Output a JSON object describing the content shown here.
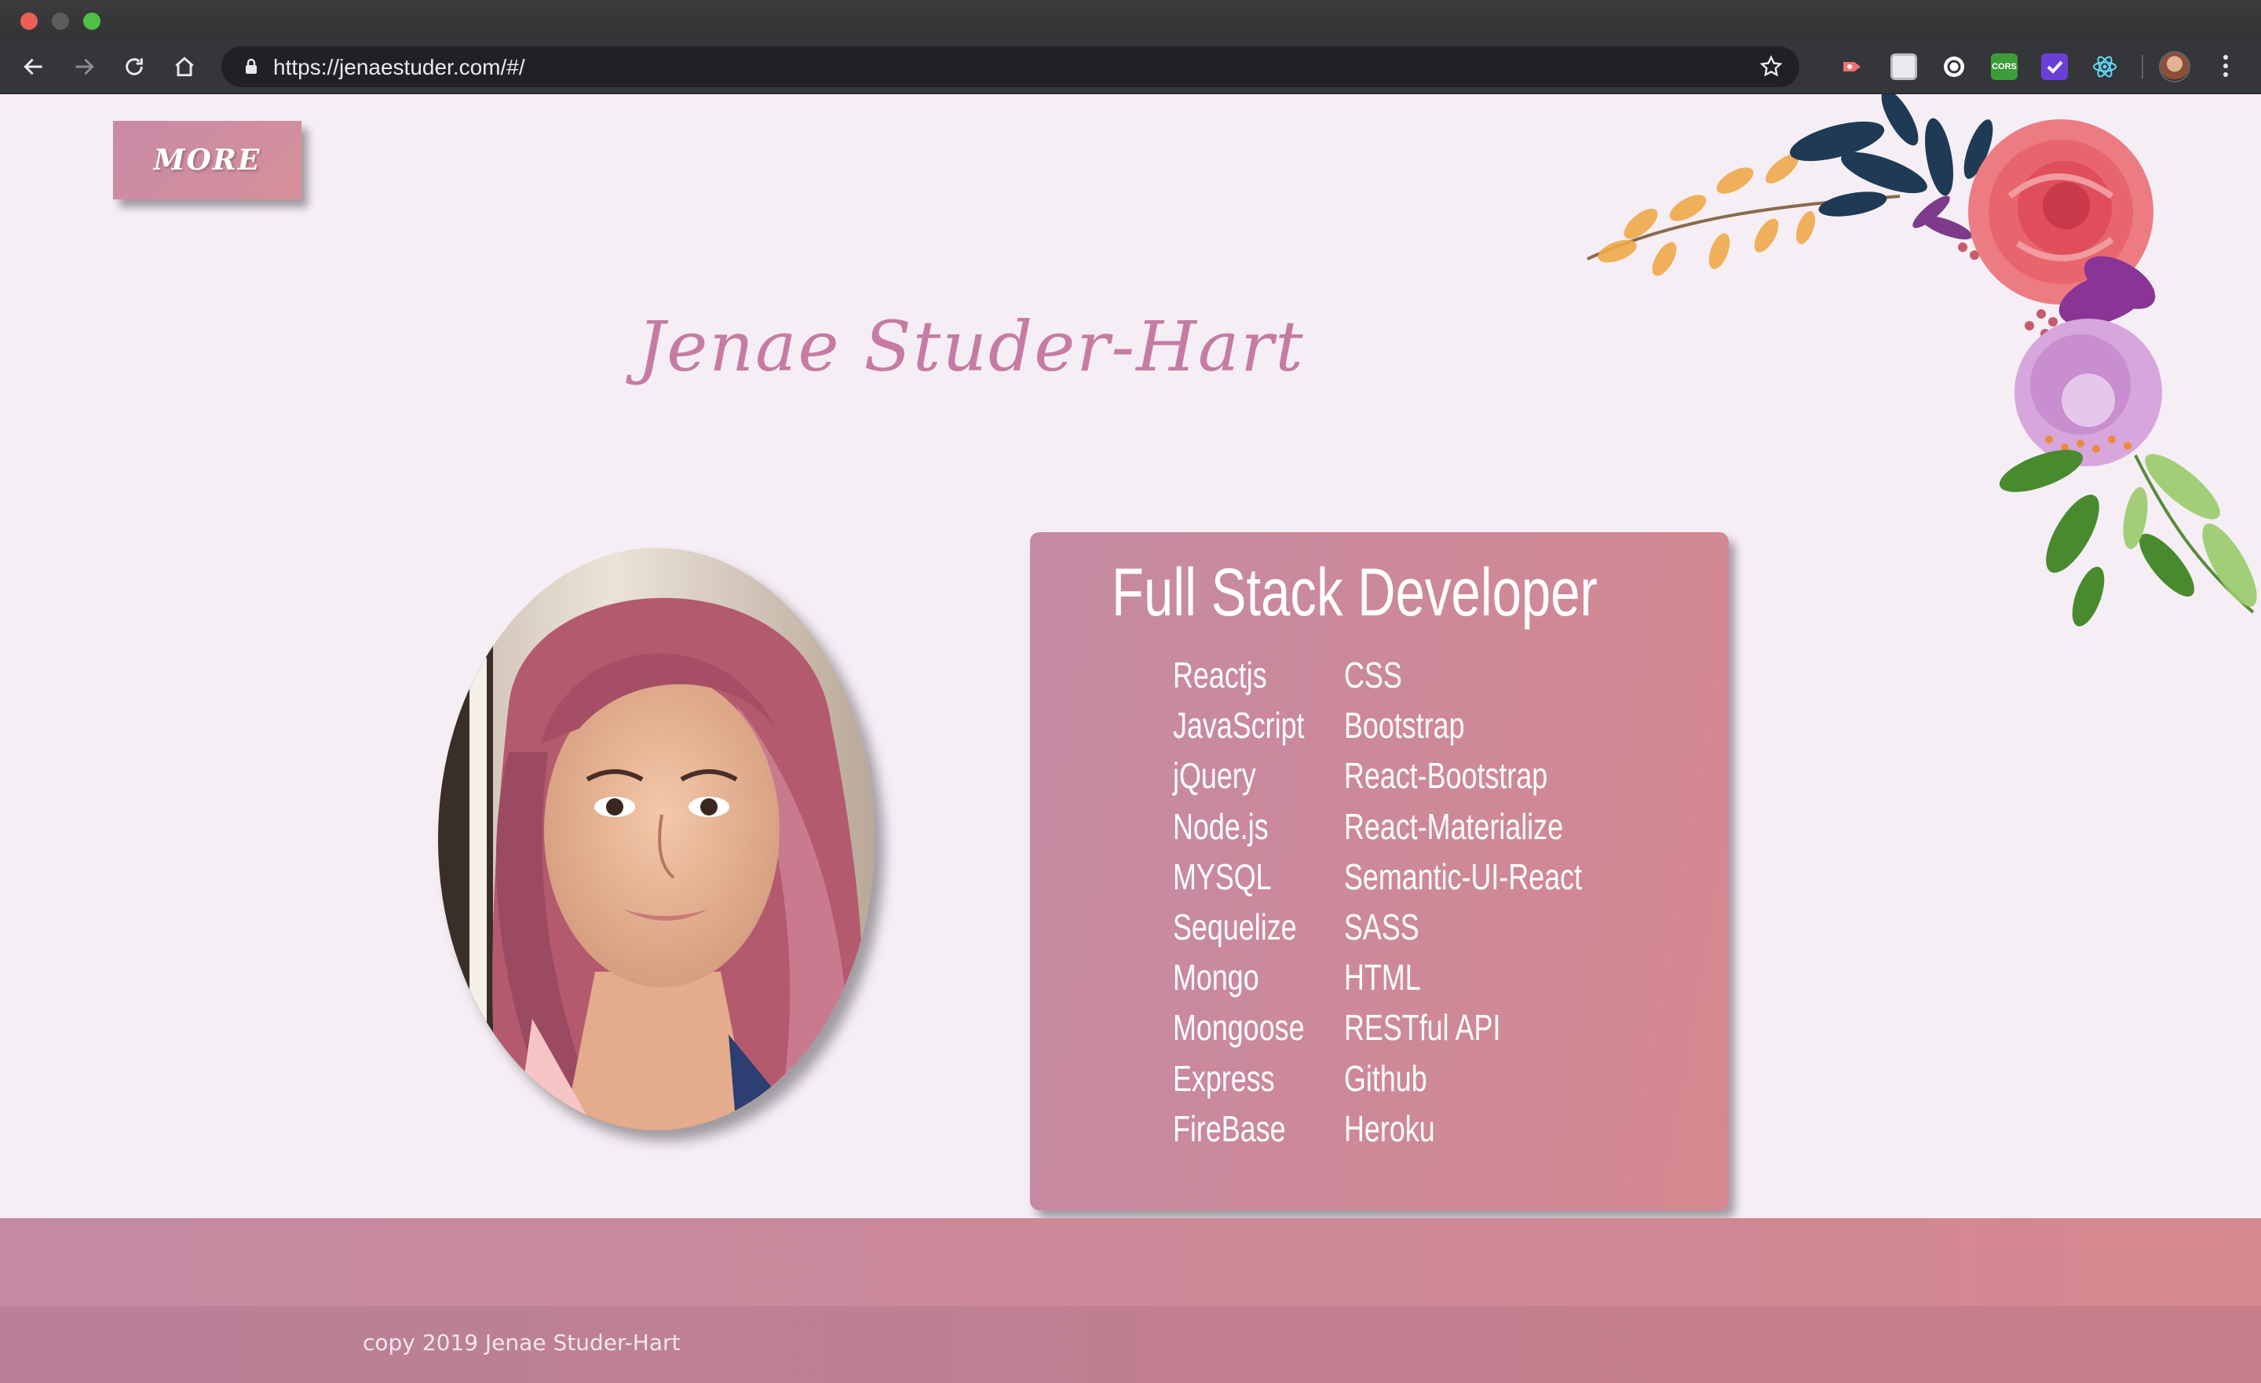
{
  "browser": {
    "url": "https://jenaestuder.com/#/",
    "url_scheme": "https://",
    "url_rest": "jenaestuder.com/#/",
    "extensions": [
      "recorder-extension-icon",
      "page-extension-icon",
      "circle-extension-icon",
      "cors-extension-icon",
      "check-extension-icon",
      "react-devtools-icon"
    ],
    "cors_label": "CORS"
  },
  "nav": {
    "more_label": "MORE"
  },
  "header": {
    "name": "Jenae Studer-Hart"
  },
  "skills": {
    "title": "Full Stack Developer",
    "column1": [
      "Reactjs",
      "JavaScript",
      "jQuery",
      "Node.js",
      "MYSQL",
      "Sequelize",
      "Mongo",
      "Mongoose",
      "Express",
      "FireBase"
    ],
    "column2": [
      "CSS",
      "Bootstrap",
      "React-Bootstrap",
      "React-Materialize",
      "Semantic-UI-React",
      "SASS",
      "HTML",
      "RESTful API",
      "Github",
      "Heroku"
    ]
  },
  "footer": {
    "copyright": "copy 2019 Jenae Studer-Hart"
  },
  "colors": {
    "page_bg": "#f5eef5",
    "accent_pink": "#c67ca2",
    "card_start": "#c48aa3",
    "card_end": "#d5888f"
  }
}
